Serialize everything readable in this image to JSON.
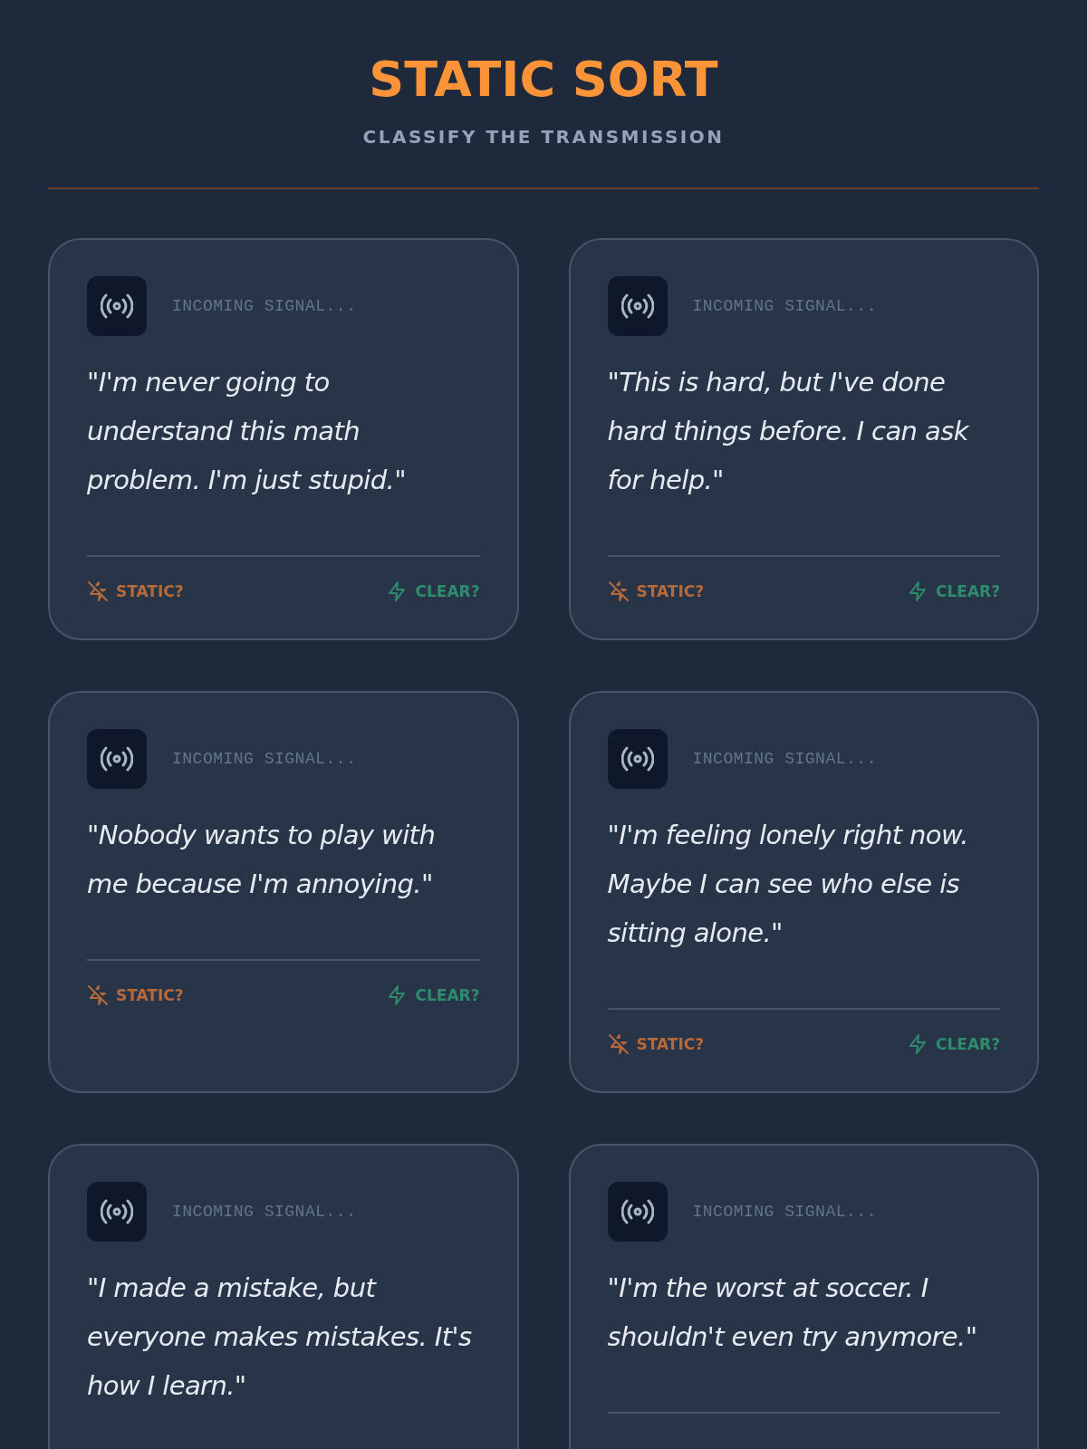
{
  "header": {
    "title": "STATIC SORT",
    "subtitle": "CLASSIFY THE TRANSMISSION"
  },
  "cards": [
    {
      "label": "INCOMING SIGNAL...",
      "quote": "\"I'm never going to understand this math problem. I'm just stupid.\"",
      "actions": [
        {
          "label": "STATIC?",
          "kind": "static"
        },
        {
          "label": "CLEAR?",
          "kind": "clear"
        }
      ]
    },
    {
      "label": "INCOMING SIGNAL...",
      "quote": "\"This is hard, but I've done hard things before. I can ask for help.\"",
      "actions": [
        {
          "label": "STATIC?",
          "kind": "static"
        },
        {
          "label": "CLEAR?",
          "kind": "clear"
        }
      ]
    },
    {
      "label": "INCOMING SIGNAL...",
      "quote": "\"Nobody wants to play with me because I'm annoying.\"",
      "actions": [
        {
          "label": "STATIC?",
          "kind": "static"
        },
        {
          "label": "CLEAR?",
          "kind": "clear"
        }
      ]
    },
    {
      "label": "INCOMING SIGNAL...",
      "quote": "\"I'm feeling lonely right now. Maybe I can see who else is sitting alone.\"",
      "actions": [
        {
          "label": "STATIC?",
          "kind": "static"
        },
        {
          "label": "CLEAR?",
          "kind": "clear"
        }
      ]
    },
    {
      "label": "INCOMING SIGNAL...",
      "quote": "\"I made a mistake, but everyone makes mistakes. It's how I learn.\""
    },
    {
      "label": "INCOMING SIGNAL...",
      "quote": "\"I'm the worst at soccer. I shouldn't even try anymore.\""
    }
  ]
}
